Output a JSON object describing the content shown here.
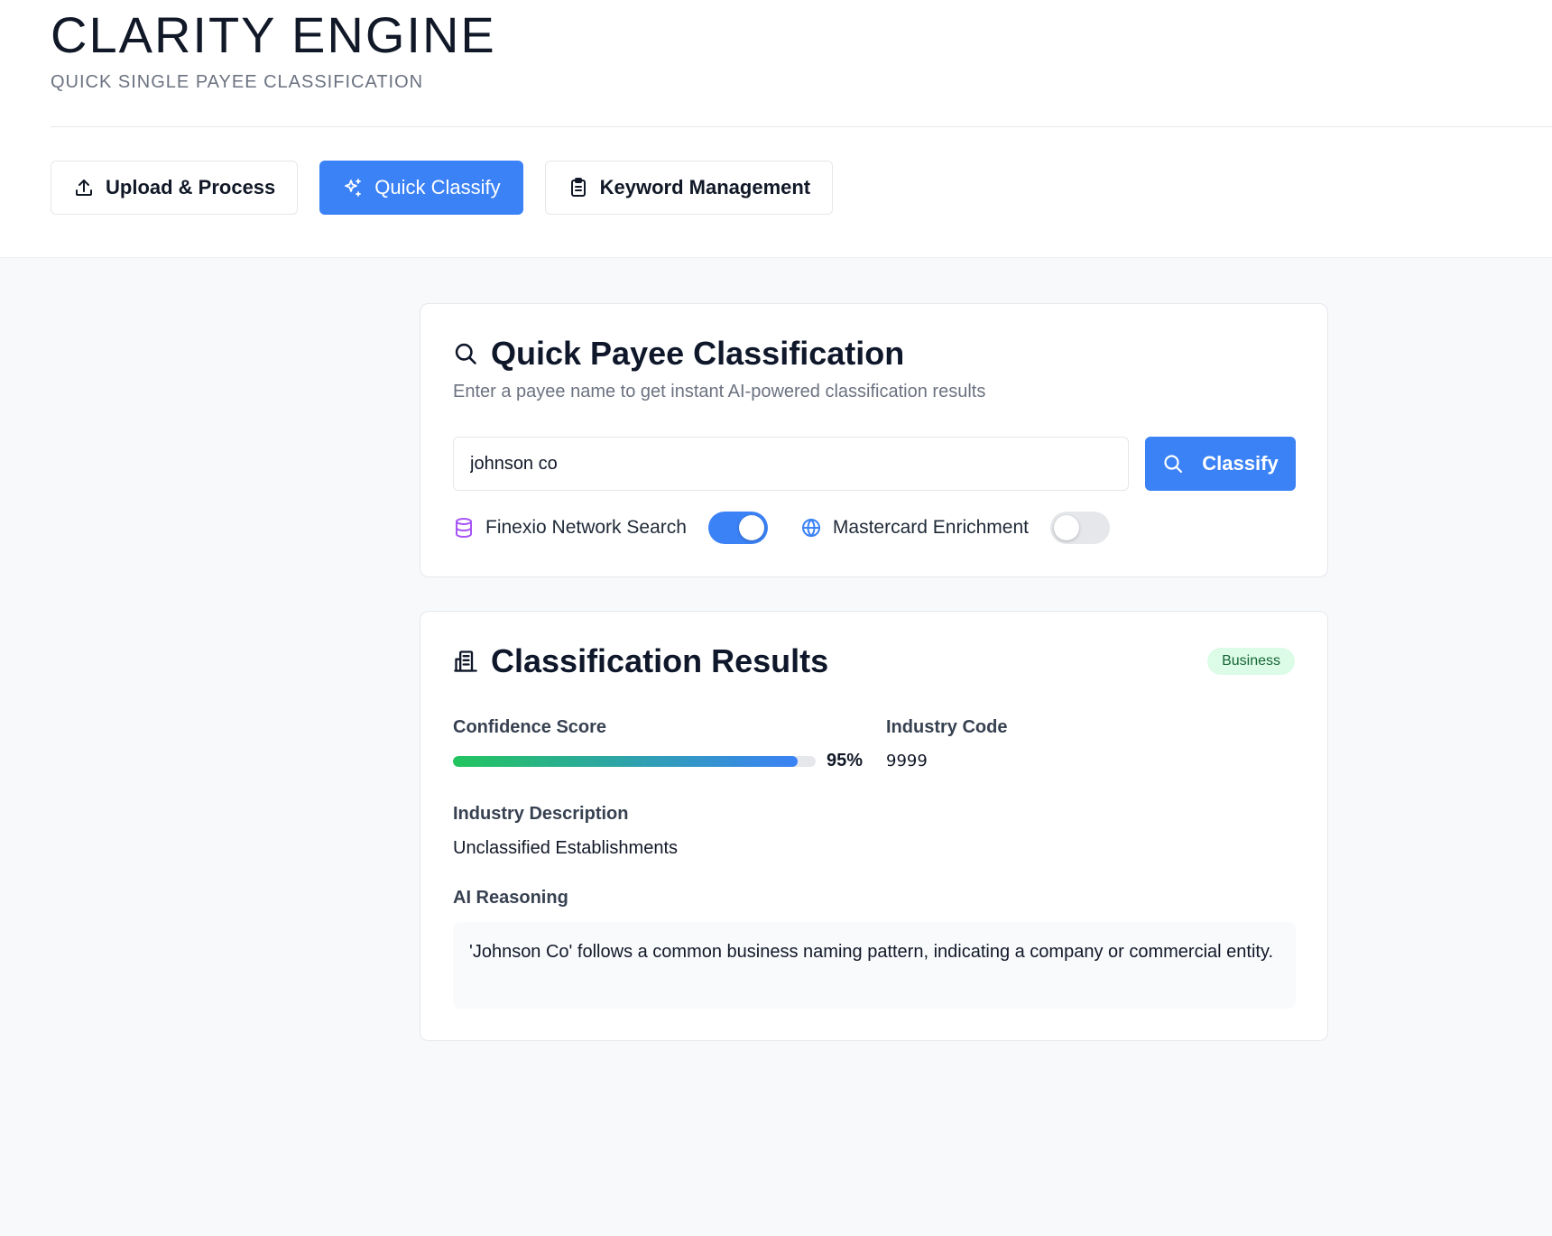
{
  "header": {
    "title": "CLARITY ENGINE",
    "subtitle": "QUICK SINGLE PAYEE CLASSIFICATION"
  },
  "tabs": [
    {
      "label": "Upload & Process",
      "icon": "upload-icon",
      "active": false
    },
    {
      "label": "Quick Classify",
      "icon": "sparkles-icon",
      "active": true
    },
    {
      "label": "Keyword Management",
      "icon": "clipboard-icon",
      "active": false
    }
  ],
  "quick": {
    "title": "Quick Payee Classification",
    "description": "Enter a payee name to get instant AI-powered classification results",
    "input_value": "johnson co",
    "classify_label": "Classify",
    "options": [
      {
        "label": "Finexio Network Search",
        "icon": "database-icon",
        "enabled": true
      },
      {
        "label": "Mastercard Enrichment",
        "icon": "globe-icon",
        "enabled": false
      }
    ]
  },
  "results": {
    "title": "Classification Results",
    "badge": "Business",
    "confidence_label": "Confidence Score",
    "confidence_value": "95%",
    "confidence_fraction": 0.95,
    "industry_code_label": "Industry Code",
    "industry_code": "9999",
    "industry_desc_label": "Industry Description",
    "industry_desc": "Unclassified Establishments",
    "reasoning_label": "AI Reasoning",
    "reasoning": "'Johnson Co' follows a common business naming pattern, indicating a company or commercial entity."
  },
  "colors": {
    "accent": "#3b82f6",
    "badge_bg": "#dcfce7",
    "badge_text": "#166534",
    "database_icon": "#a855f7",
    "globe_icon": "#3b82f6"
  }
}
